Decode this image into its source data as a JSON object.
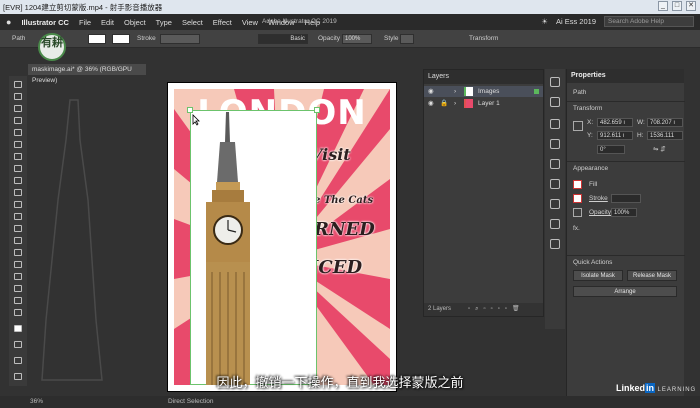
{
  "player": {
    "title": "[EVR] 1204建立剪切蒙版.mp4 - 射手影音播放器",
    "min": "_",
    "max": "□",
    "close": "✕"
  },
  "menubar": {
    "app_name": "Illustrator CC",
    "items": [
      "File",
      "Edit",
      "Object",
      "Type",
      "Select",
      "Effect",
      "View",
      "Window",
      "Help"
    ],
    "workspace": "Ai Ess 2019",
    "search_placeholder": "Search Adobe Help"
  },
  "control_bar": {
    "selection_label": "Path",
    "stroke_label": "Stroke",
    "app_version": "Adobe Illustrator CC 2019",
    "stroke_style": "Basic",
    "opacity_label": "Opacity",
    "opacity_value": "100%",
    "style_label": "Style",
    "transform_label": "Transform"
  },
  "document": {
    "tab_title": "maskimage.ai* @ 36% (RGB/GPU Preview)",
    "zoom": "36%",
    "tool_status": "Direct Selection"
  },
  "poster": {
    "headline": "LONDON",
    "line1": "Visit",
    "line2": "e The Cats",
    "line3": "RNED",
    "line4": "ICED"
  },
  "layers_panel": {
    "title": "Layers",
    "layers": [
      {
        "name": "Images",
        "visible": true,
        "locked": false,
        "selected": true
      },
      {
        "name": "Layer 1",
        "visible": true,
        "locked": true,
        "selected": false
      }
    ],
    "footer": "2 Layers"
  },
  "properties_panel": {
    "title": "Properties",
    "selection": "Path",
    "transform_title": "Transform",
    "x_label": "X:",
    "x_value": "482.659 ı",
    "w_label": "W:",
    "w_value": "708.207 ı",
    "y_label": "Y:",
    "y_value": "912.611 ı",
    "h_label": "H:",
    "h_value": "1536.111",
    "angle_value": "0°",
    "appearance_title": "Appearance",
    "fill_label": "Fill",
    "stroke_label": "Stroke",
    "opacity_label": "Opacity",
    "opacity_value": "100%",
    "fx_label": "fx.",
    "quick_actions_title": "Quick Actions",
    "isolate_mask": "Isolate Mask",
    "release_mask": "Release Mask",
    "arrange": "Arrange"
  },
  "subtitle": "因此，撤销一下操作，直到我选择蒙版之前",
  "watermark": {
    "brand": "Linked",
    "brand_in": "in",
    "sub": "LEARNING",
    "badge": "有耕"
  },
  "colors": {
    "poster_pink": "#e84a6b",
    "poster_ray": "#f6c9b9",
    "selection_green": "#6cc36c"
  }
}
